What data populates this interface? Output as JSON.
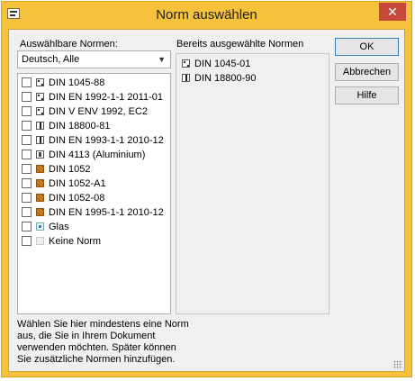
{
  "window": {
    "title": "Norm auswählen",
    "close_glyph": "✕"
  },
  "left": {
    "label": "Auswählbare Normen:",
    "filter_value": "Deutsch, Alle",
    "items": [
      {
        "label": "DIN 1045-88",
        "icon": "dots-icon"
      },
      {
        "label": "DIN EN 1992-1-1 2011-01",
        "icon": "dots-icon"
      },
      {
        "label": "DIN V ENV 1992, EC2",
        "icon": "dots-icon"
      },
      {
        "label": "DIN 18800-81",
        "icon": "steel-icon"
      },
      {
        "label": "DIN EN 1993-1-1 2010-12",
        "icon": "steel-icon"
      },
      {
        "label": "DIN 4113 (Aluminium)",
        "icon": "aluminium-icon"
      },
      {
        "label": "DIN 1052",
        "icon": "timber-icon"
      },
      {
        "label": "DIN 1052-A1",
        "icon": "timber-icon"
      },
      {
        "label": "DIN 1052-08",
        "icon": "timber-icon"
      },
      {
        "label": "DIN EN 1995-1-1 2010-12",
        "icon": "timber-icon"
      },
      {
        "label": "Glas",
        "icon": "glass-icon"
      },
      {
        "label": "Keine Norm",
        "icon": "no-norm-icon"
      }
    ]
  },
  "right": {
    "label": "Bereits ausgewählte Normen",
    "items": [
      {
        "label": "DIN 1045-01",
        "icon": "dots-icon"
      },
      {
        "label": "DIN 18800-90",
        "icon": "steel-icon"
      }
    ]
  },
  "buttons": {
    "ok": "OK",
    "cancel": "Abbrechen",
    "help": "Hilfe"
  },
  "hint_lines": [
    "Wählen Sie hier mindestens eine Norm",
    "aus, die Sie in Ihrem Dokument",
    "verwenden möchten. Später können",
    "Sie zusätzliche Normen hinzufügen."
  ]
}
